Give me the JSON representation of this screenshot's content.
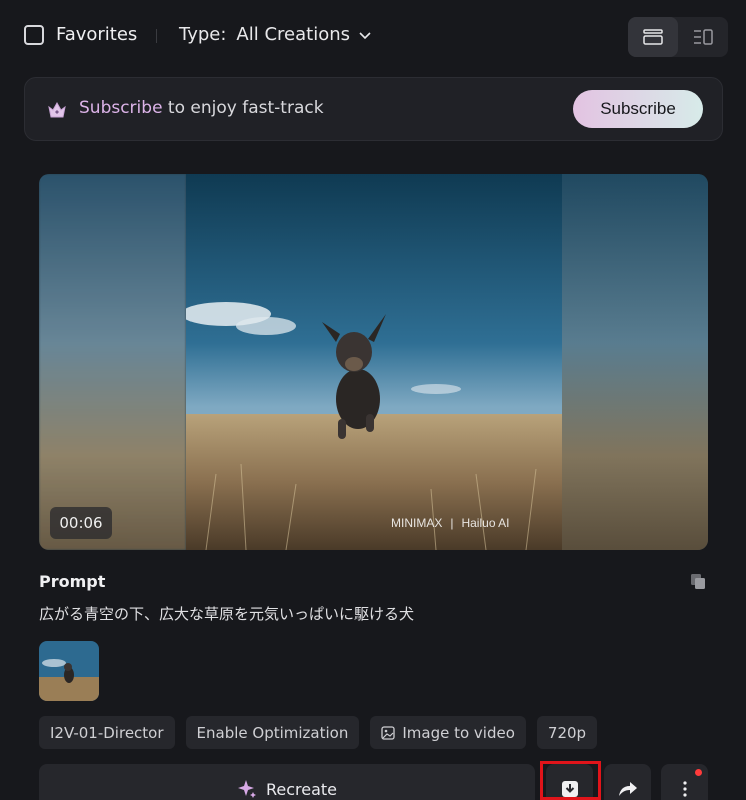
{
  "toolbar": {
    "favorites_label": "Favorites",
    "type_label": "Type:",
    "type_value": "All Creations"
  },
  "banner": {
    "accent": "Subscribe",
    "text": " to enjoy fast-track",
    "button_label": "Subscribe"
  },
  "video": {
    "timestamp": "00:06",
    "watermark_left": "MINIMAX",
    "watermark_right": "Hailuo AI"
  },
  "prompt": {
    "title": "Prompt",
    "text": "広がる青空の下、広大な草原を元気いっぱいに駆ける犬"
  },
  "tags": [
    "I2V-01-Director",
    "Enable Optimization",
    "Image to video",
    "720p"
  ],
  "actions": {
    "recreate_label": "Recreate"
  },
  "colors": {
    "background": "#17181c",
    "accent": "#dcb3e8",
    "highlight": "#e0141a"
  },
  "icons": [
    "chevron-down-icon",
    "list-view-icon",
    "card-view-icon",
    "crown-icon",
    "copy-icon",
    "image-icon",
    "sparkle-icon",
    "download-icon",
    "share-icon",
    "more-icon"
  ]
}
